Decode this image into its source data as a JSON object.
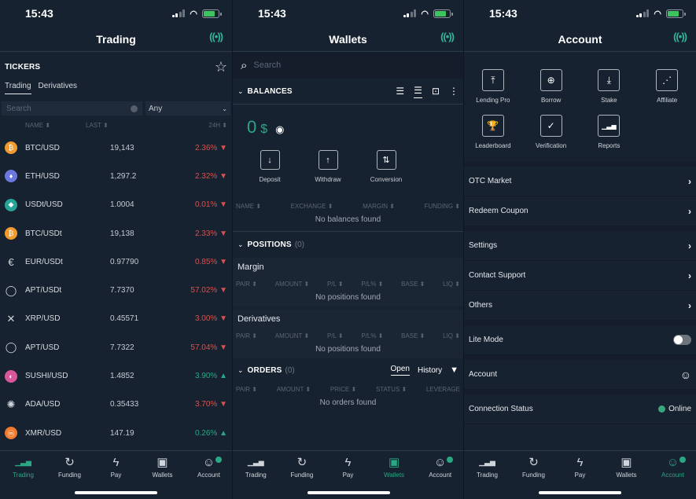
{
  "status_bar": {
    "time": "15:43"
  },
  "colors": {
    "accent": "#2aa784",
    "negative": "#d6524f",
    "background": "#172230"
  },
  "trading": {
    "title": "Trading",
    "connection_icon": "broadcast-icon",
    "tickers_label": "TICKERS",
    "subtabs": [
      {
        "label": "Trading",
        "active": true
      },
      {
        "label": "Derivatives",
        "active": false
      }
    ],
    "search_placeholder": "Search",
    "market_filter": "Any",
    "columns": {
      "name": "NAME ⬍",
      "last": "LAST ⬍",
      "change": "24H ⬍"
    },
    "tickers": [
      {
        "pair": "BTC/USD",
        "last": "19,143",
        "change": "2.36% ▼",
        "dir": "down",
        "icon": "bitcoin-icon",
        "glyph": "₿",
        "color": "#f09b2f"
      },
      {
        "pair": "ETH/USD",
        "last": "1,297.2",
        "change": "2.32% ▼",
        "dir": "down",
        "icon": "ethereum-icon",
        "glyph": "♦",
        "color": "#6a77dc"
      },
      {
        "pair": "USDt/USD",
        "last": "1.0004",
        "change": "0.01% ▼",
        "dir": "down",
        "icon": "tether-icon",
        "glyph": "◆",
        "color": "#26a495"
      },
      {
        "pair": "BTC/USDt",
        "last": "19,138",
        "change": "2.33% ▼",
        "dir": "down",
        "icon": "bitcoin-icon",
        "glyph": "₿",
        "color": "#f09b2f"
      },
      {
        "pair": "EUR/USDt",
        "last": "0.97790",
        "change": "0.85% ▼",
        "dir": "down",
        "icon": "euro-icon",
        "glyph": "€",
        "color": "transparent"
      },
      {
        "pair": "APT/USDt",
        "last": "7.7370",
        "change": "57.02% ▼",
        "dir": "down",
        "icon": "aptos-icon",
        "glyph": "◯",
        "color": "transparent"
      },
      {
        "pair": "XRP/USD",
        "last": "0.45571",
        "change": "3.00% ▼",
        "dir": "down",
        "icon": "xrp-icon",
        "glyph": "✕",
        "color": "transparent"
      },
      {
        "pair": "APT/USD",
        "last": "7.7322",
        "change": "57.04% ▼",
        "dir": "down",
        "icon": "aptos-icon",
        "glyph": "◯",
        "color": "transparent"
      },
      {
        "pair": "SUSHI/USD",
        "last": "1.4852",
        "change": "3.90% ▲",
        "dir": "up",
        "icon": "sushi-icon",
        "glyph": "◐",
        "color": "#d6589a"
      },
      {
        "pair": "ADA/USD",
        "last": "0.35433",
        "change": "3.70% ▼",
        "dir": "down",
        "icon": "cardano-icon",
        "glyph": "✺",
        "color": "transparent"
      },
      {
        "pair": "XMR/USD",
        "last": "147.19",
        "change": "0.26% ▲",
        "dir": "up",
        "icon": "monero-icon",
        "glyph": "ⓜ",
        "color": "#f0792b"
      }
    ]
  },
  "wallets": {
    "title": "Wallets",
    "search_placeholder": "Search",
    "balances_label": "BALANCES",
    "balance_amount": "0",
    "balance_currency": "$",
    "actions": [
      {
        "label": "Deposit",
        "icon": "arrow-down-icon",
        "glyph": "↓"
      },
      {
        "label": "Withdraw",
        "icon": "arrow-up-icon",
        "glyph": "↑"
      },
      {
        "label": "Conversion",
        "icon": "swap-icon",
        "glyph": "⇅"
      }
    ],
    "balances_columns": [
      "NAME ⬍",
      "EXCHANGE ⬍",
      "MARGIN ⬍",
      "FUNDING ⬍"
    ],
    "balances_empty": "No balances found",
    "positions_label": "POSITIONS",
    "positions_count": "(0)",
    "margin_label": "Margin",
    "derivatives_label": "Derivatives",
    "positions_columns": [
      "PAIR ⬍",
      "AMOUNT ⬍",
      "P/L ⬍",
      "P/L% ⬍",
      "BASE ⬍",
      "LIQ ⬍"
    ],
    "positions_empty": "No positions found",
    "orders_label": "ORDERS",
    "orders_count": "(0)",
    "orders_tabs": [
      {
        "label": "Open",
        "active": true
      },
      {
        "label": "History",
        "active": false
      }
    ],
    "orders_columns": [
      "PAIR ⬍",
      "AMOUNT ⬍",
      "PRICE ⬍",
      "STATUS ⬍",
      "LEVERAGE"
    ],
    "orders_empty": "No orders found"
  },
  "account": {
    "title": "Account",
    "grid": [
      {
        "label": "Lending Pro",
        "icon": "upload-icon",
        "glyph": "⤒"
      },
      {
        "label": "Borrow",
        "icon": "circle-arrow-down-icon",
        "glyph": "⊕"
      },
      {
        "label": "Stake",
        "icon": "download-icon",
        "glyph": "⤓"
      },
      {
        "label": "Affiliate",
        "icon": "share-icon",
        "glyph": "⋰"
      },
      {
        "label": "Leaderboard",
        "icon": "trophy-icon",
        "glyph": "🏆"
      },
      {
        "label": "Verification",
        "icon": "shield-check-icon",
        "glyph": "✓"
      },
      {
        "label": "Reports",
        "icon": "bar-chart-icon",
        "glyph": "▁▃▅"
      }
    ],
    "menu_group1": [
      {
        "label": "OTC Market"
      },
      {
        "label": "Redeem Coupon"
      }
    ],
    "menu_group2": [
      {
        "label": "Settings"
      },
      {
        "label": "Contact Support"
      },
      {
        "label": "Others"
      }
    ],
    "lite_mode_label": "Lite Mode",
    "lite_mode_on": false,
    "account_label": "Account",
    "connection_label": "Connection Status",
    "connection_value": "Online"
  },
  "tabbar": [
    {
      "label": "Trading",
      "icon": "chart-icon",
      "glyph": "📈"
    },
    {
      "label": "Funding",
      "icon": "refresh-icon",
      "glyph": "↻"
    },
    {
      "label": "Pay",
      "icon": "bolt-icon",
      "glyph": "ϟ"
    },
    {
      "label": "Wallets",
      "icon": "wallet-icon",
      "glyph": "▣"
    },
    {
      "label": "Account",
      "icon": "user-icon",
      "glyph": "☺"
    }
  ]
}
